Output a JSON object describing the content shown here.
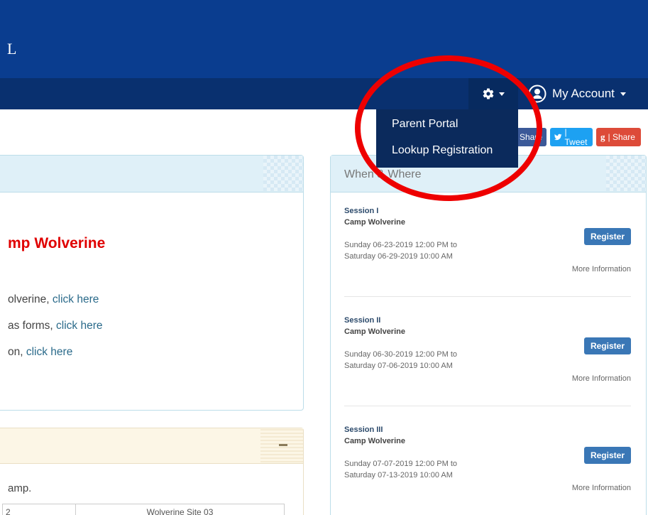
{
  "banner": {
    "title": "L"
  },
  "navbar": {
    "account_label": "My Account"
  },
  "dropdown": {
    "items": [
      "Parent Portal",
      "Lookup Registration"
    ]
  },
  "share": {
    "facebook": "Share",
    "twitter": "| Tweet",
    "google": "| Share"
  },
  "left_panel": {
    "heading": "mp Wolverine",
    "lines": [
      {
        "prefix": "olverine, ",
        "link": "click here"
      },
      {
        "prefix": "as forms, ",
        "link": "click here"
      },
      {
        "prefix": "on, ",
        "link": "click here"
      }
    ]
  },
  "left_panel2": {
    "text": "amp.",
    "table_row": [
      "2",
      "Wolverine Site 03"
    ]
  },
  "when_where": {
    "title": "When & Where",
    "register_label": "Register",
    "more_info_label": "More Information",
    "sessions": [
      {
        "name": "Session I",
        "location": "Camp Wolverine",
        "start": "Sunday 06-23-2019 12:00 PM to",
        "end": "Saturday 06-29-2019 10:00 AM"
      },
      {
        "name": "Session II",
        "location": "Camp Wolverine",
        "start": "Sunday 06-30-2019 12:00 PM to",
        "end": "Saturday 07-06-2019 10:00 AM"
      },
      {
        "name": "Session III",
        "location": "Camp Wolverine",
        "start": "Sunday 07-07-2019 12:00 PM to",
        "end": "Saturday 07-13-2019 10:00 AM"
      }
    ]
  },
  "colors": {
    "banner": "#0a3d8f",
    "navbar": "#09306f",
    "dropdown": "#0b2a5c",
    "register": "#3a77b6",
    "heading_red": "#e00000",
    "annotation": "#ee0000"
  }
}
